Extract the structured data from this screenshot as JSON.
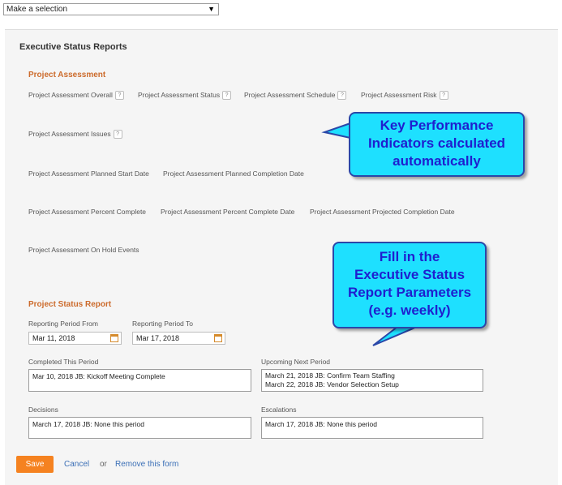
{
  "top_select": {
    "value": "Make a selection",
    "arrow": "▼"
  },
  "page_title": "Executive Status Reports",
  "project_assessment": {
    "heading": "Project Assessment",
    "overall": "Project Assessment Overall",
    "status": "Project Assessment Status",
    "schedule": "Project Assessment Schedule",
    "risk": "Project Assessment Risk",
    "issues": "Project Assessment Issues",
    "planned_start": "Project Assessment Planned Start Date",
    "planned_completion": "Project Assessment Planned Completion Date",
    "percent_complete": "Project Assessment Percent Complete",
    "percent_complete_date": "Project Assessment Percent Complete Date",
    "projected_completion": "Project Assessment Projected Completion Date",
    "on_hold": "Project Assessment On Hold Events",
    "help_glyph": "?"
  },
  "project_status_report": {
    "heading": "Project Status Report",
    "period_from_label": "Reporting Period From",
    "period_from_value": "Mar 11, 2018",
    "period_to_label": "Reporting Period To",
    "period_to_value": "Mar 17, 2018",
    "completed_label": "Completed This Period",
    "completed_value": "Mar 10, 2018 JB: Kickoff Meeting Complete",
    "upcoming_label": "Upcoming Next Period",
    "upcoming_line1": "March 21, 2018 JB: Confirm Team Staffing",
    "upcoming_line2": "March 22, 2018 JB: Vendor Selection Setup",
    "decisions_label": "Decisions",
    "decisions_value": "March 17, 2018 JB: None this period",
    "escalations_label": "Escalations",
    "escalations_value": "March 17, 2018 JB: None this period"
  },
  "actions": {
    "save": "Save",
    "cancel": "Cancel",
    "or": "or",
    "remove": "Remove this form"
  },
  "callouts": {
    "kpi": [
      "Key Performance",
      "Indicators calculated",
      "automatically"
    ],
    "fill": [
      "Fill in the",
      "Executive Status",
      "Report Parameters",
      "(e.g. weekly)"
    ]
  },
  "colors": {
    "accent": "#f58220",
    "section": "#cc6b2c",
    "link": "#3b6fb6",
    "callout_bg": "#1ee0ff",
    "callout_text": "#1f1fcf"
  }
}
